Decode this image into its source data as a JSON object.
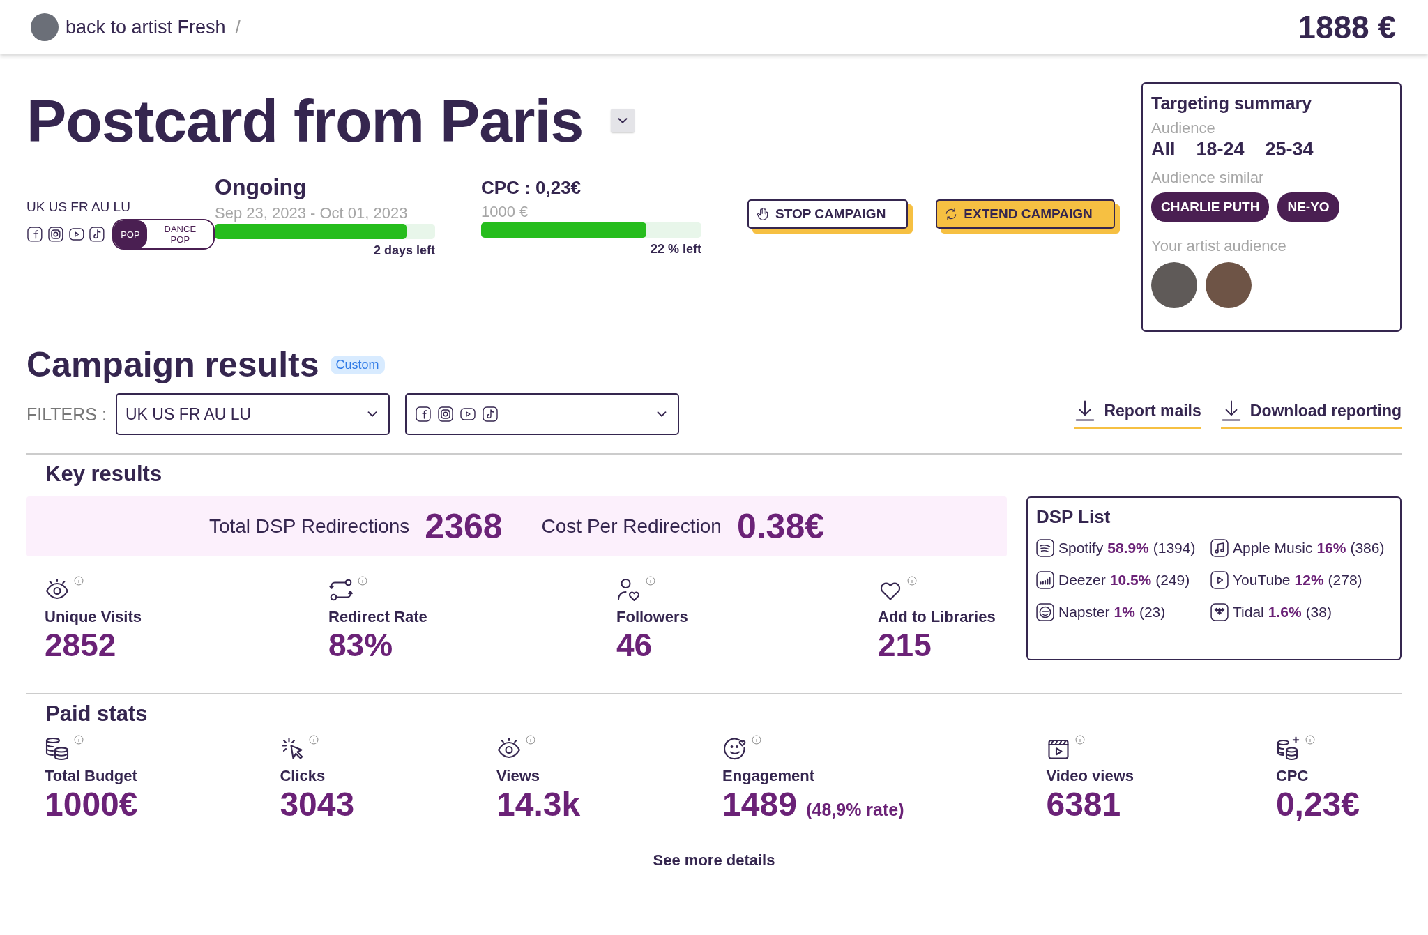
{
  "header": {
    "back_link": "back to artist Fresh",
    "separator": "/",
    "balance": "1888 €"
  },
  "campaign": {
    "title": "Postcard from Paris",
    "countries": "UK US FR AU LU",
    "genres": [
      {
        "label": "POP",
        "selected": true
      },
      {
        "label": "DANCE POP",
        "selected": false
      }
    ],
    "status": {
      "label": "Ongoing",
      "dates": "Sep 23, 2023 - Oct 01, 2023",
      "level": 0.87,
      "remaining": "2 days left"
    },
    "budget": {
      "cpc": "CPC : 0,23€",
      "amount": "1000 €",
      "level": 0.75,
      "remaining": "22 % left"
    },
    "buttons": [
      {
        "label": "STOP CAMPAIGN",
        "kind": "outline"
      },
      {
        "label": "EXTEND CAMPAIGN",
        "kind": "filled"
      }
    ]
  },
  "targeting_summary": {
    "title": "Targeting summary",
    "audience_label": "Audience",
    "audience": [
      "All",
      "18-24",
      "25-34"
    ],
    "similar_label": "Audience similar",
    "similar": [
      "CHARLIE PUTH",
      "NE-YO"
    ],
    "artist_audience_label": "Your artist audience"
  },
  "results": {
    "title": "Campaign results",
    "badge": "Custom",
    "filters_label": "FILTERS :",
    "country_filter": "UK US FR AU LU",
    "actions": [
      "Report mails",
      "Download reporting"
    ]
  },
  "key_results": {
    "title": "Key results",
    "banner": [
      {
        "label": "Total DSP Redirections",
        "value": "2368"
      },
      {
        "label": "Cost Per Redirection",
        "value": "0.38€"
      }
    ],
    "metrics": [
      {
        "kind": "eye",
        "label": "Unique Visits",
        "value": "2852"
      },
      {
        "kind": "redirect",
        "label": "Redirect Rate",
        "value": "83%"
      },
      {
        "kind": "followers",
        "label": "Followers",
        "value": "46"
      },
      {
        "kind": "heart",
        "label": "Add to Libraries",
        "value": "215"
      }
    ]
  },
  "dsp_list": {
    "title": "DSP List",
    "items": [
      {
        "kind": "spotify",
        "name": "Spotify",
        "share": "58.9%",
        "count": "(1394)"
      },
      {
        "kind": "apple",
        "name": "Apple Music",
        "share": "16%",
        "count": "(386)"
      },
      {
        "kind": "deezer",
        "name": "Deezer",
        "share": "10.5%",
        "count": "(249)"
      },
      {
        "kind": "youtube",
        "name": "YouTube",
        "share": "12%",
        "count": "(278)"
      },
      {
        "kind": "napster",
        "name": "Napster",
        "share": "1%",
        "count": "(23)"
      },
      {
        "kind": "tidal",
        "name": "Tidal",
        "share": "1.6%",
        "count": "(38)"
      }
    ]
  },
  "paid_stats": {
    "title": "Paid stats",
    "metrics": [
      {
        "kind": "budget",
        "label": "Total Budget",
        "value": "1000€"
      },
      {
        "kind": "clicks",
        "label": "Clicks",
        "value": "3043"
      },
      {
        "kind": "eye",
        "label": "Views",
        "value": "14.3k"
      },
      {
        "kind": "engagement",
        "label": "Engagement",
        "value": "1489",
        "note": "(48,9% rate)"
      },
      {
        "kind": "video",
        "label": "Video views",
        "value": "6381"
      },
      {
        "kind": "cpc",
        "label": "CPC",
        "value": "0,23€"
      }
    ]
  },
  "footer_link": "See more details"
}
